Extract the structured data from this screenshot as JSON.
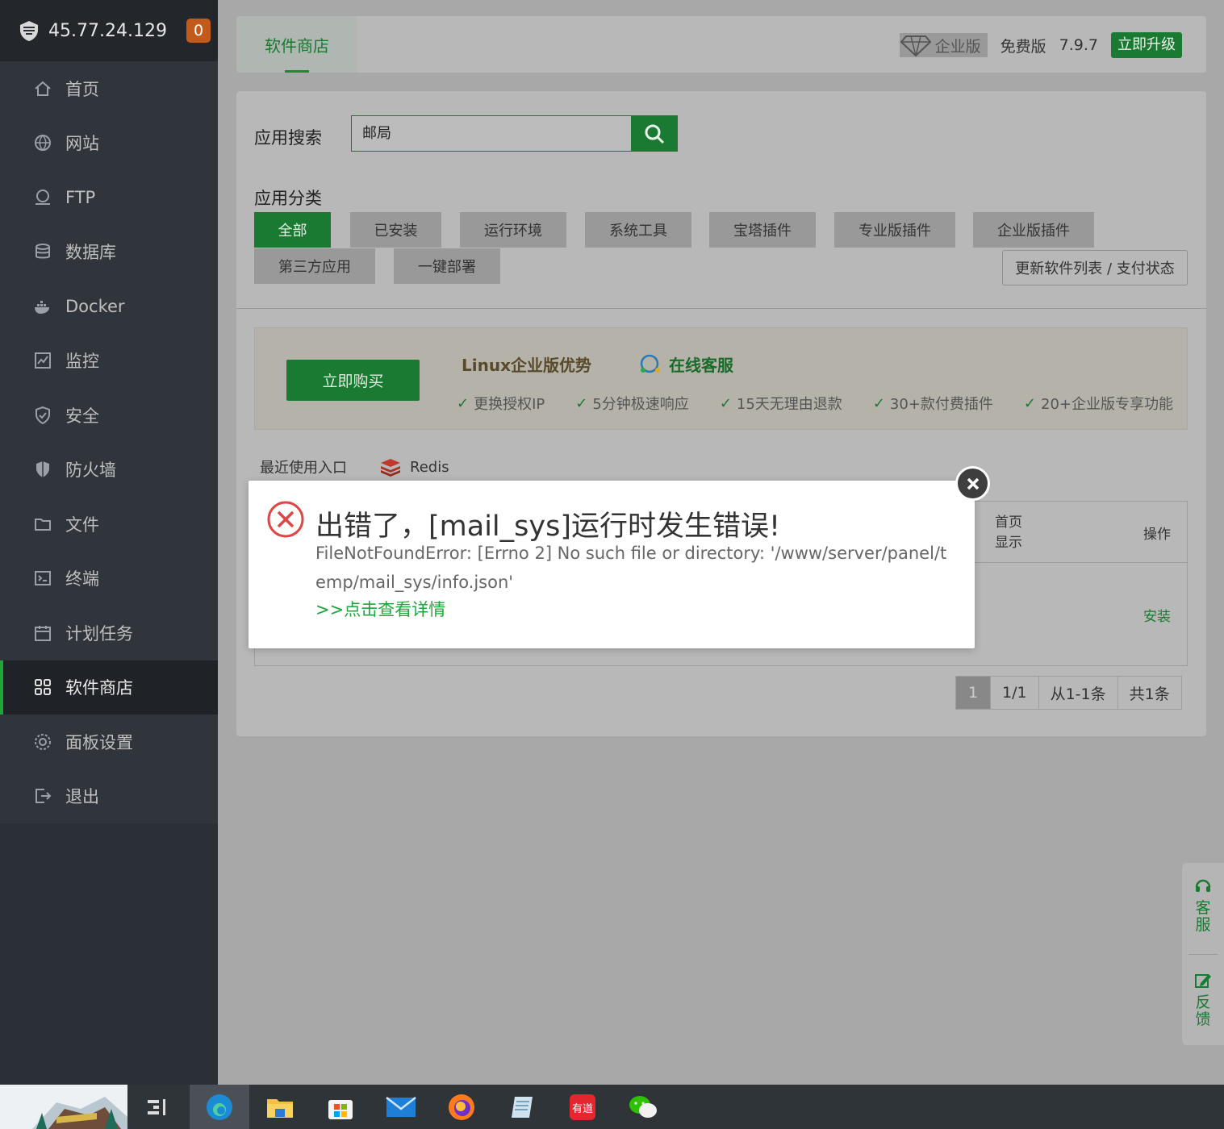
{
  "sidebar": {
    "host": "45.77.24.129",
    "badge": "0",
    "items": [
      {
        "label": "首页",
        "icon": "home-icon"
      },
      {
        "label": "网站",
        "icon": "globe-icon"
      },
      {
        "label": "FTP",
        "icon": "ftp-icon"
      },
      {
        "label": "数据库",
        "icon": "database-icon"
      },
      {
        "label": "Docker",
        "icon": "docker-icon"
      },
      {
        "label": "监控",
        "icon": "monitor-icon"
      },
      {
        "label": "安全",
        "icon": "shield-check-icon"
      },
      {
        "label": "防火墙",
        "icon": "firewall-icon"
      },
      {
        "label": "文件",
        "icon": "folder-icon"
      },
      {
        "label": "终端",
        "icon": "terminal-icon"
      },
      {
        "label": "计划任务",
        "icon": "calendar-icon"
      },
      {
        "label": "软件商店",
        "icon": "apps-grid-icon"
      },
      {
        "label": "面板设置",
        "icon": "gear-icon"
      },
      {
        "label": "退出",
        "icon": "logout-icon"
      }
    ],
    "active_index": 11
  },
  "topbar": {
    "tab": "软件商店",
    "enterprise": "企业版",
    "free": "免费版",
    "version": "7.9.7",
    "upgrade": "立即升级"
  },
  "search": {
    "label": "应用搜索",
    "value": "邮局"
  },
  "categories": {
    "label": "应用分类",
    "items": [
      "全部",
      "已安装",
      "运行环境",
      "系统工具",
      "宝塔插件",
      "专业版插件",
      "企业版插件",
      "第三方应用",
      "一键部署"
    ],
    "refresh": "更新软件列表 / 支付状态"
  },
  "promo": {
    "buy": "立即购买",
    "title": "Linux企业版优势",
    "cs": "在线客服",
    "features": [
      "更换授权IP",
      "5分钟极速响应",
      "15天无理由退款",
      "30+款付费插件",
      "20+企业版专享功能"
    ]
  },
  "recent": {
    "label": "最近使用入口",
    "app": "Redis"
  },
  "table": {
    "col_home": "首页显示",
    "col_op": "操作",
    "install": "安装"
  },
  "pager": {
    "current": "1",
    "pages": "1/1",
    "range": "从1-1条",
    "total": "共1条"
  },
  "floater": {
    "service": "客服",
    "feedback": "反馈"
  },
  "dialog": {
    "title": "出错了，[mail_sys]运行时发生错误!",
    "message": "FileNotFoundError: [Errno 2] No such file or directory: '/www/server/panel/temp/mail_sys/info.json'",
    "link": ">>点击查看详情"
  },
  "colors": {
    "accent": "#20a53a",
    "sidebar_bg": "#2b3036"
  }
}
